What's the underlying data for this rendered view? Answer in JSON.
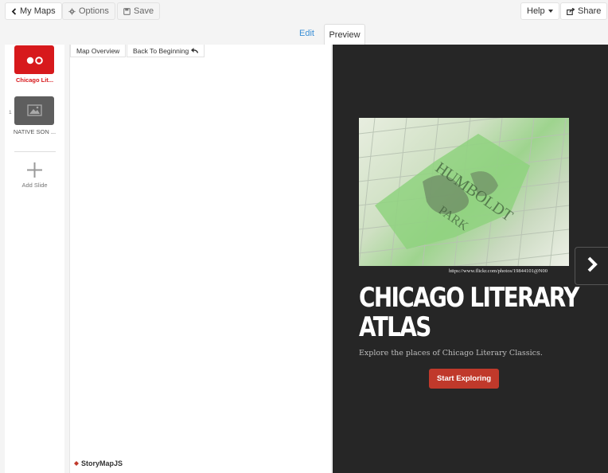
{
  "toolbar": {
    "my_maps_label": "My Maps",
    "options_label": "Options",
    "save_label": "Save",
    "help_label": "Help",
    "share_label": "Share"
  },
  "view_tabs": {
    "edit_label": "Edit",
    "preview_label": "Preview"
  },
  "slides": [
    {
      "number": "",
      "label": "Chicago Lit...",
      "selected": true
    },
    {
      "number": "1",
      "label": "NATIVE SON ...",
      "selected": false
    }
  ],
  "add_slide_label": "Add Slide",
  "editor": {
    "map_overview_label": "Map Overview",
    "back_to_beginning_label": "Back To Beginning",
    "brand_label": "StoryMapJS"
  },
  "preview": {
    "credit": "https://www.flickr.com/photos/19844101@N00",
    "title_line1": "CHICAGO LITERARY",
    "title_line2": "ATLAS",
    "subtitle": "Explore the places of Chicago Literary Classics.",
    "start_button_label": "Start Exploring"
  },
  "colors": {
    "accent_red": "#d7191c",
    "link_blue": "#3a8fd6",
    "preview_bg": "#262626",
    "start_button": "#c0392b"
  }
}
